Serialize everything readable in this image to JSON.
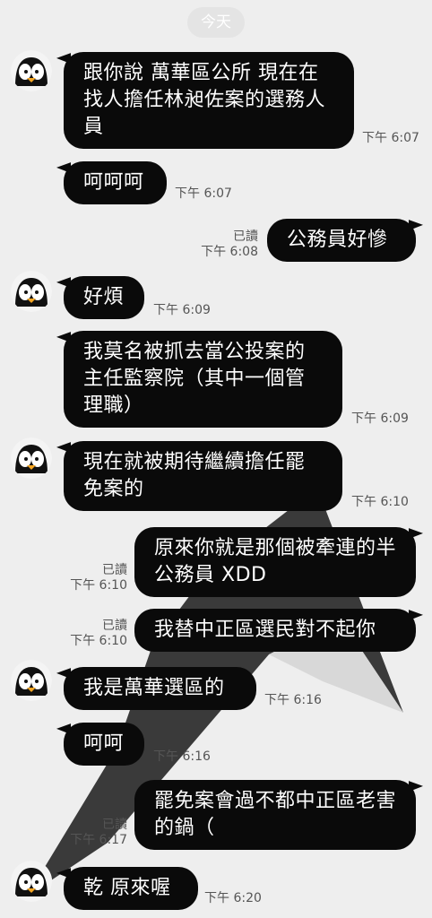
{
  "date_divider": "今天",
  "messages": [
    {
      "text": "跟你說 萬華區公所 現在在找人擔任林昶佐案的選務人員",
      "time": "下午 6:07"
    },
    {
      "text": "呵呵呵",
      "time": "下午 6:07"
    },
    {
      "text": "公務員好慘",
      "time": "下午 6:08",
      "read": "已讀"
    },
    {
      "text": "好煩",
      "time": "下午 6:09"
    },
    {
      "text": "我莫名被抓去當公投案的主任監察院（其中一個管理職）",
      "time": "下午 6:09"
    },
    {
      "text": "現在就被期待繼續擔任罷免案的",
      "time": "下午 6:10"
    },
    {
      "text": "原來你就是那個被牽連的半公務員 XDD",
      "time": "下午 6:10",
      "read": "已讀"
    },
    {
      "text": "我替中正區選民對不起你",
      "time": "下午 6:10",
      "read": "已讀"
    },
    {
      "text": "我是萬華選區的",
      "time": "下午 6:16"
    },
    {
      "text": "呵呵",
      "time": "下午 6:16"
    },
    {
      "text": "罷免案會過不都中正區老害的鍋（",
      "time": "下午 6:17",
      "read": "已讀"
    },
    {
      "text": "乾 原來喔",
      "time": "下午 6:20"
    }
  ],
  "avatar_icon": "penguin-icon",
  "colors": {
    "bubble": "#0a0a0a",
    "background": "#eeeeee",
    "text": "#ffffff"
  }
}
